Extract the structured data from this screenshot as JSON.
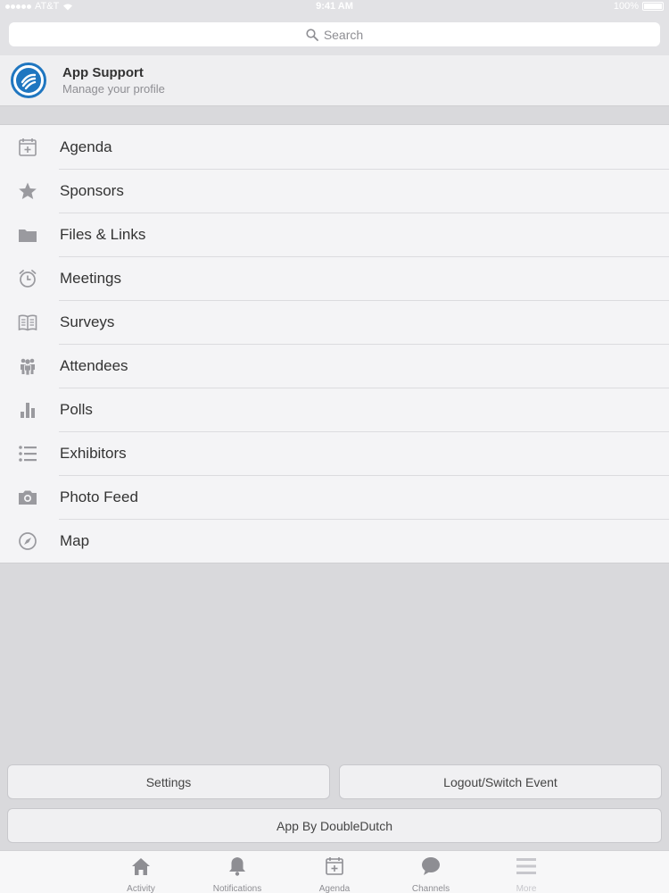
{
  "status_bar": {
    "carrier": "AT&T",
    "time": "9:41 AM",
    "battery": "100%"
  },
  "search": {
    "placeholder": "Search"
  },
  "profile": {
    "name": "App Support",
    "subtitle": "Manage your profile"
  },
  "menu": {
    "items": [
      {
        "label": "Agenda",
        "icon": "calendar-icon"
      },
      {
        "label": "Sponsors",
        "icon": "star-icon"
      },
      {
        "label": "Files & Links",
        "icon": "folder-icon"
      },
      {
        "label": "Meetings",
        "icon": "alarm-clock-icon"
      },
      {
        "label": "Surveys",
        "icon": "book-icon"
      },
      {
        "label": "Attendees",
        "icon": "people-icon"
      },
      {
        "label": "Polls",
        "icon": "bar-chart-icon"
      },
      {
        "label": "Exhibitors",
        "icon": "list-icon"
      },
      {
        "label": "Photo Feed",
        "icon": "camera-icon"
      },
      {
        "label": "Map",
        "icon": "compass-icon"
      }
    ]
  },
  "buttons": {
    "settings": "Settings",
    "logout": "Logout/Switch Event",
    "app_by": "App By DoubleDutch"
  },
  "tabs": [
    {
      "label": "Activity",
      "icon": "home-icon"
    },
    {
      "label": "Notifications",
      "icon": "bell-icon"
    },
    {
      "label": "Agenda",
      "icon": "calendar-icon"
    },
    {
      "label": "Channels",
      "icon": "chat-bubble-icon"
    },
    {
      "label": "More",
      "icon": "menu-icon"
    }
  ],
  "colors": {
    "accent": "#1f76c0",
    "icon_gray": "#9a9a9f",
    "background": "#d9d9dc"
  }
}
